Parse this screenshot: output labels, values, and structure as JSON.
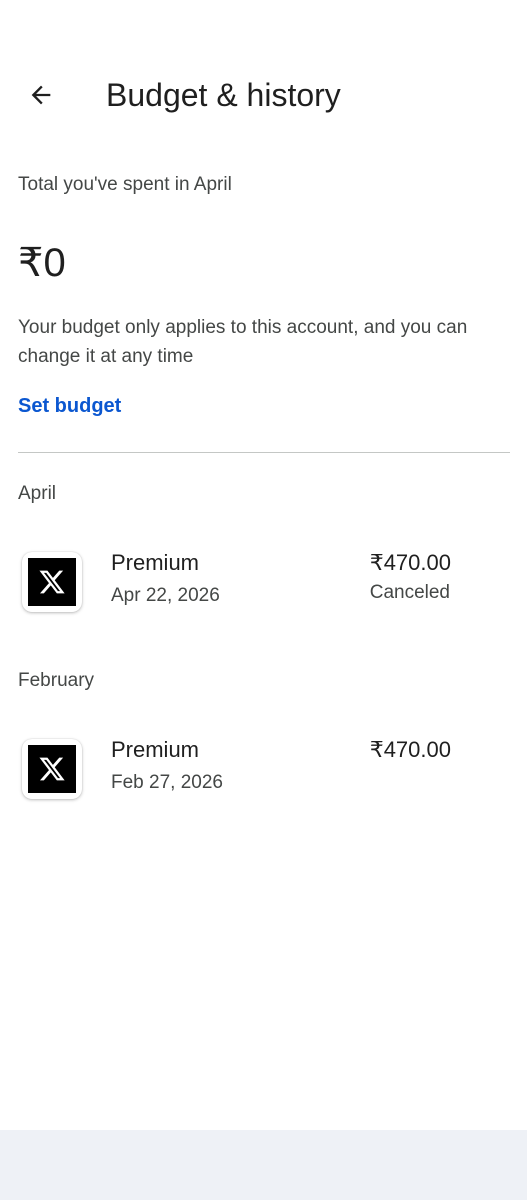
{
  "header": {
    "title": "Budget & history",
    "back_icon": "arrow-back-icon"
  },
  "summary": {
    "spent_label": "Total you've spent in April",
    "total": "₹0",
    "note": "Your budget only applies to this account, and you can change it at any time",
    "set_budget_label": "Set budget"
  },
  "sections": [
    {
      "month": "April",
      "items": [
        {
          "icon": "x-app-icon",
          "title": "Premium",
          "date": "Apr 22, 2026",
          "price": "₹470.00",
          "status": "Canceled"
        }
      ]
    },
    {
      "month": "February",
      "items": [
        {
          "icon": "x-app-icon",
          "title": "Premium",
          "date": "Feb 27, 2026",
          "price": "₹470.00",
          "status": ""
        }
      ]
    }
  ],
  "colors": {
    "accent": "#0b57d0",
    "text_primary": "#1f1f1f",
    "text_secondary": "#444746",
    "divider": "#c4c7c5",
    "nav_bar": "#eef1f6"
  }
}
